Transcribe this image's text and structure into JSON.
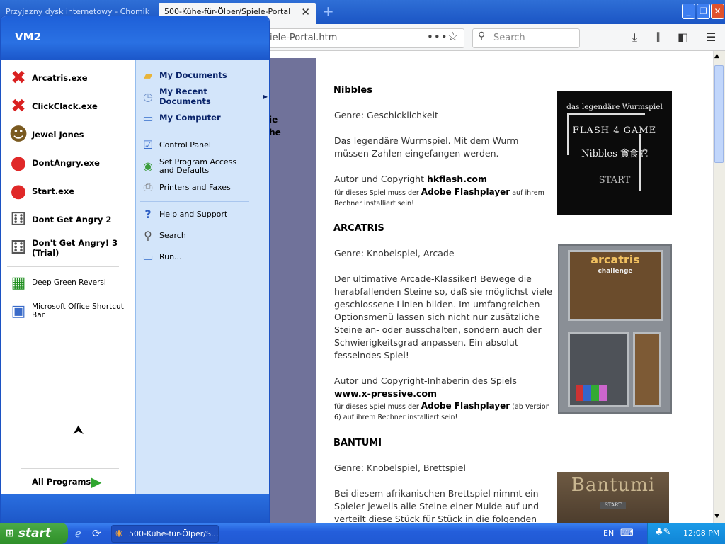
{
  "browser": {
    "tabs": [
      {
        "label": "Przyjazny dysk internetowy - Chomik"
      },
      {
        "label": "500-Kühe-für-Ölper/Spiele-Portal"
      }
    ],
    "url_tail": "iele-Portal.htm",
    "search_placeholder": "Search"
  },
  "page": {
    "left_text": [
      "ie",
      "ihe"
    ],
    "games": [
      {
        "title": "Nibbles",
        "genre": "Genre: Geschicklichkeit",
        "desc": "Das legendäre Wurmspiel. Mit dem Wurm müssen Zahlen eingefangen werden.",
        "author_prefix": "Autor und Copyright ",
        "author": "hkflash.com",
        "req_prefix": "für dieses Spiel muss der ",
        "req_player": "Adobe Flashplayer",
        "req_suffix": " auf ihrem Rechner installiert sein!",
        "image_lines": [
          "das legendäre Wurmspiel",
          "FLASH 4 GAME",
          "Nibbles 貪食蛇",
          "START"
        ]
      },
      {
        "title": "ARCATRIS",
        "genre": "Genre: Knobelspiel, Arcade",
        "desc": "Der ultimative Arcade-Klassiker! Bewege die herabfallenden Steine so, daß sie möglichst viele geschlossene Linien bilden. Im umfangreichen Optionsmenü lassen sich nicht nur zusätzliche Steine an- oder ausschalten, sondern auch der Schwierigkeitsgrad anpassen. Ein absolut fesselndes Spiel!",
        "author_prefix": "Autor und Copyright-Inhaberin des Spiels ",
        "author": "www.x-pressive.com",
        "req_prefix": "für dieses Spiel muss der ",
        "req_player": "Adobe Flashplayer",
        "req_suffix": " (ab Version 6) auf ihrem Rechner installiert sein!",
        "image_lines": [
          "arcatris",
          "challenge"
        ]
      },
      {
        "title": "BANTUMI",
        "genre": "Genre: Knobelspiel, Brettspiel",
        "desc": "Bei diesem afrikanischen Brettspiel nimmt ein Spieler jeweils alle Steine einer Mulde auf und verteilt diese Stück für Stück in die folgenden",
        "image_lines": [
          "Bantumi",
          "START"
        ]
      }
    ]
  },
  "start_menu": {
    "user": "VM2",
    "pinned": [
      {
        "label": "Arcatris.exe",
        "icon": "red-x-icon"
      },
      {
        "label": "ClickClack.exe",
        "icon": "red-x-icon"
      },
      {
        "label": "Jewel Jones",
        "icon": "explorer-hat-icon"
      },
      {
        "label": "DontAngry.exe",
        "icon": "red-ball-icon"
      },
      {
        "label": "Start.exe",
        "icon": "red-ball-icon"
      },
      {
        "label": "Dont Get Angry 2",
        "icon": "dice-icon"
      },
      {
        "label": "Don't Get Angry! 3 (Trial)",
        "icon": "dice-icon"
      }
    ],
    "recent": [
      {
        "label": "Deep Green Reversi",
        "icon": "reversi-icon"
      },
      {
        "label": "Microsoft Office Shortcut Bar",
        "icon": "office-icon"
      }
    ],
    "all_programs": "All Programs",
    "right": [
      {
        "label": "My Documents",
        "bold": true,
        "icon": "folder-icon"
      },
      {
        "label": "My Recent Documents",
        "bold": true,
        "icon": "recent-docs-icon",
        "arrow": "▶"
      },
      {
        "label": "My Computer",
        "bold": true,
        "icon": "computer-icon"
      },
      {
        "label": "Control Panel",
        "bold": false,
        "icon": "control-panel-icon"
      },
      {
        "label": "Set Program Access and Defaults",
        "bold": false,
        "icon": "program-access-icon"
      },
      {
        "label": "Printers and Faxes",
        "bold": false,
        "icon": "printer-icon"
      },
      {
        "label": "Help and Support",
        "bold": false,
        "icon": "help-icon"
      },
      {
        "label": "Search",
        "bold": false,
        "icon": "search-icon"
      },
      {
        "label": "Run...",
        "bold": false,
        "icon": "run-icon"
      }
    ]
  },
  "taskbar": {
    "start_label": "start",
    "task_label": "500-Kühe-für-Ölper/S...",
    "lang": "EN",
    "clock": "12:08 PM"
  }
}
